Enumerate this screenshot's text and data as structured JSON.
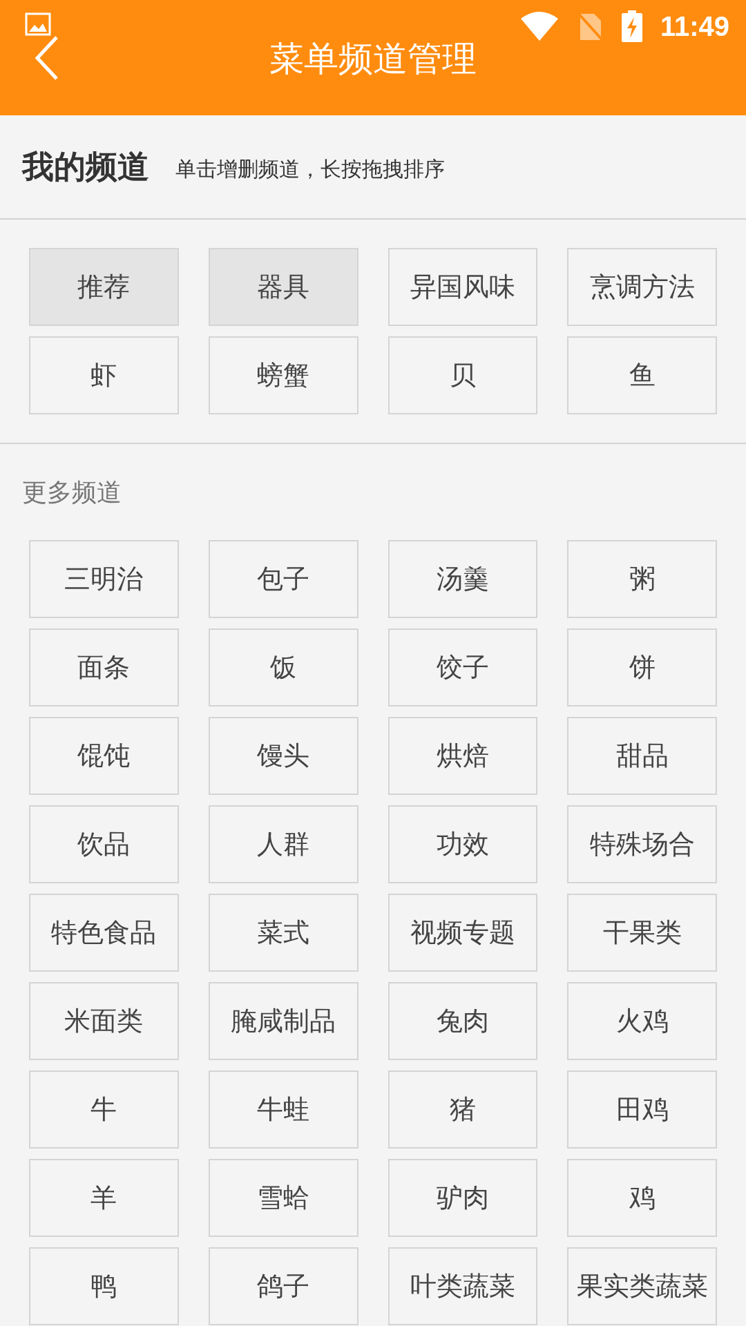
{
  "status_bar": {
    "time": "11:49"
  },
  "header": {
    "title": "菜单频道管理"
  },
  "my_channels": {
    "title": "我的频道",
    "hint": "单击增删频道，长按拖拽排序",
    "items": [
      {
        "label": "推荐",
        "fixed": true
      },
      {
        "label": "器具",
        "fixed": true
      },
      {
        "label": "异国风味",
        "fixed": false
      },
      {
        "label": "烹调方法",
        "fixed": false
      },
      {
        "label": "虾",
        "fixed": false
      },
      {
        "label": "螃蟹",
        "fixed": false
      },
      {
        "label": "贝",
        "fixed": false
      },
      {
        "label": "鱼",
        "fixed": false
      }
    ]
  },
  "more_channels": {
    "title": "更多频道",
    "items": [
      "三明治",
      "包子",
      "汤羹",
      "粥",
      "面条",
      "饭",
      "饺子",
      "饼",
      "馄饨",
      "馒头",
      "烘焙",
      "甜品",
      "饮品",
      "人群",
      "功效",
      "特殊场合",
      "特色食品",
      "菜式",
      "视频专题",
      "干果类",
      "米面类",
      "腌咸制品",
      "兔肉",
      "火鸡",
      "牛",
      "牛蛙",
      "猪",
      "田鸡",
      "羊",
      "雪蛤",
      "驴肉",
      "鸡",
      "鸭",
      "鸽子",
      "叶类蔬菜",
      "果实类蔬菜"
    ]
  }
}
